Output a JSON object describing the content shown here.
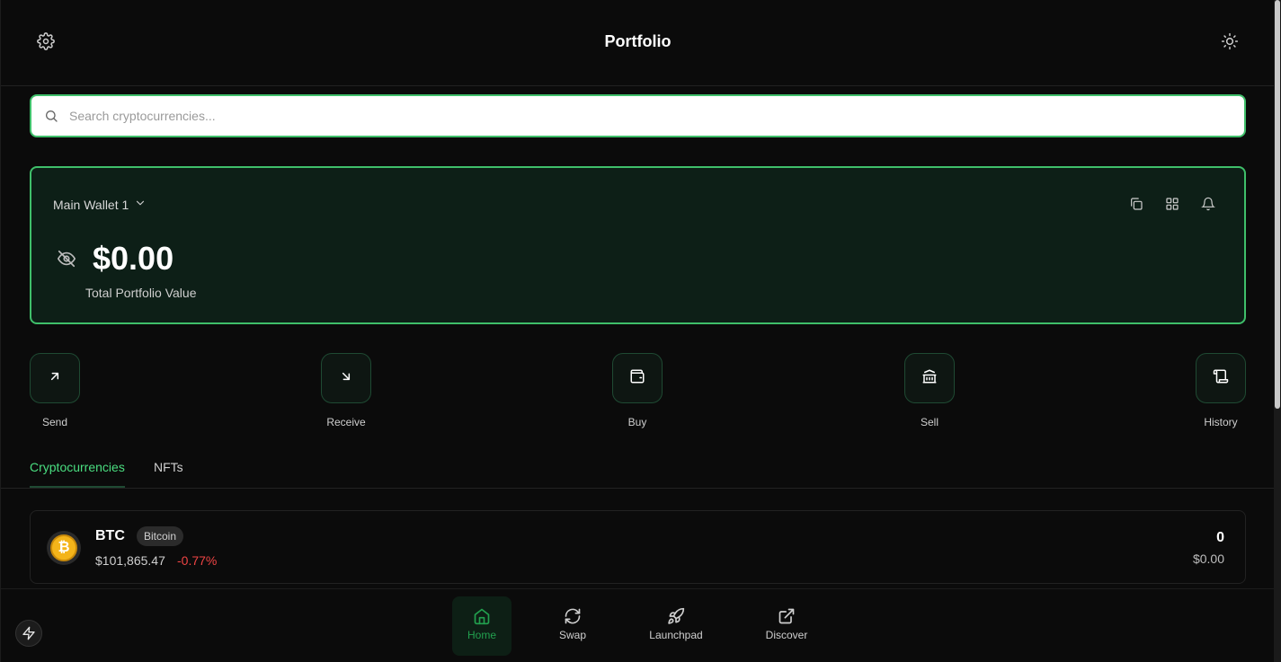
{
  "header": {
    "title": "Portfolio",
    "settings_icon": "gear-icon",
    "theme_icon": "sun-icon"
  },
  "search": {
    "placeholder": "Search cryptocurrencies...",
    "value": ""
  },
  "wallet": {
    "name": "Main Wallet 1",
    "total_value": "$0.00",
    "total_label": "Total Portfolio Value",
    "action_icons": [
      "copy-icon",
      "qr-grid-icon",
      "bell-icon"
    ],
    "accent": "#3fbf6a",
    "background": "#0d1f17"
  },
  "quick_actions": [
    {
      "label": "Send",
      "icon": "arrow-up-right-icon"
    },
    {
      "label": "Receive",
      "icon": "arrow-down-right-icon"
    },
    {
      "label": "Buy",
      "icon": "wallet-icon"
    },
    {
      "label": "Sell",
      "icon": "bank-icon"
    },
    {
      "label": "History",
      "icon": "scroll-icon"
    }
  ],
  "tabs": [
    {
      "label": "Cryptocurrencies",
      "active": true
    },
    {
      "label": "NFTs",
      "active": false
    }
  ],
  "assets": [
    {
      "symbol": "BTC",
      "name": "Bitcoin",
      "price": "$101,865.47",
      "change": "-0.77%",
      "balance": "0",
      "balance_value": "$0.00",
      "change_color": "#ef4444"
    }
  ],
  "bottom_nav": [
    {
      "label": "Home",
      "icon": "home-icon",
      "active": true
    },
    {
      "label": "Swap",
      "icon": "refresh-icon",
      "active": false
    },
    {
      "label": "Launchpad",
      "icon": "rocket-icon",
      "active": false
    },
    {
      "label": "Discover",
      "icon": "external-link-icon",
      "active": false
    }
  ]
}
